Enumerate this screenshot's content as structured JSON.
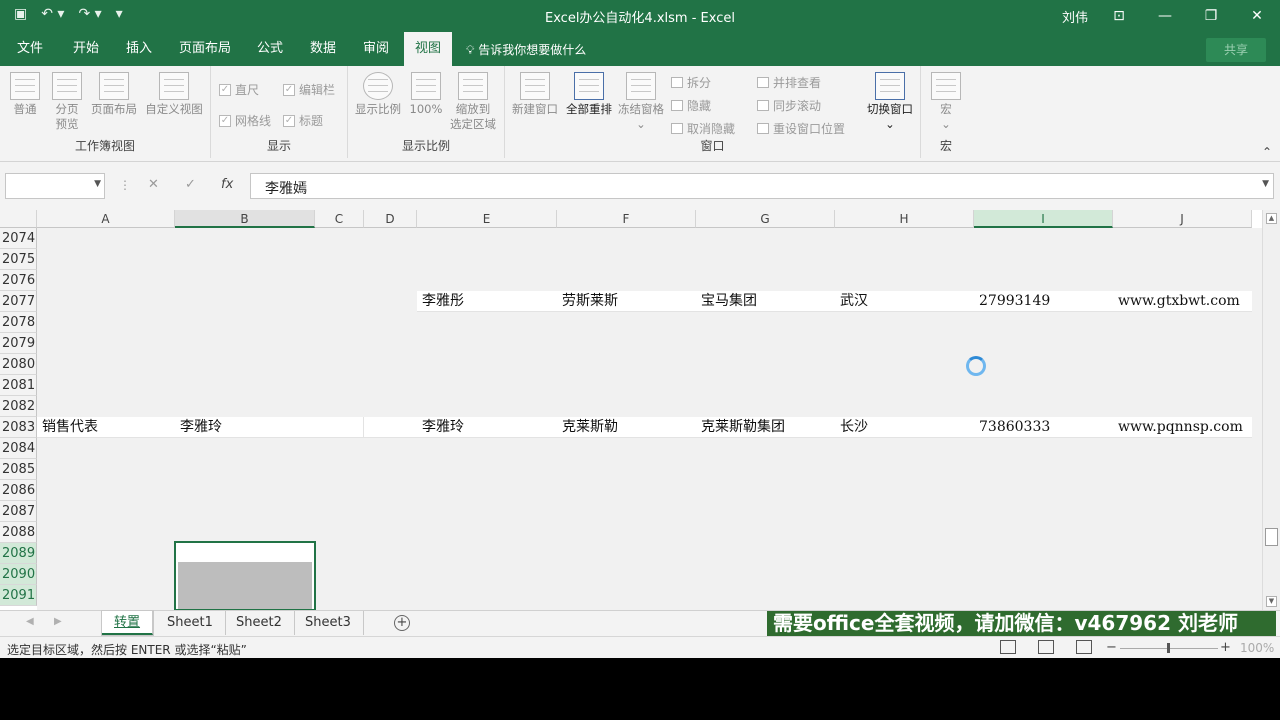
{
  "titlebar": {
    "title": "Excel办公自动化4.xlsm - Excel",
    "user": "刘伟",
    "qat": [
      "save-icon",
      "undo-icon",
      "redo-icon",
      "customize-icon"
    ],
    "buttons": [
      "ribbon-display-options",
      "minimize",
      "restore",
      "close"
    ]
  },
  "ribbon_tabs": [
    "文件",
    "开始",
    "插入",
    "页面布局",
    "公式",
    "数据",
    "审阅",
    "视图"
  ],
  "active_tab": "视图",
  "tell_me": "告诉我你想要做什么",
  "share_label": "共享",
  "ribbon": {
    "workbook_views": {
      "label": "工作簿视图",
      "buttons": [
        "普通",
        "分页\n预览",
        "页面布局",
        "自定义视图"
      ]
    },
    "show": {
      "label": "显示",
      "checks": [
        "直尺",
        "编辑栏",
        "网格线",
        "标题"
      ]
    },
    "zoom": {
      "label": "显示比例",
      "buttons": [
        "显示比例",
        "100%",
        "缩放到\n选定区域"
      ]
    },
    "window": {
      "label": "窗口",
      "buttons": [
        "新建窗口",
        "全部重排",
        "冻结窗格"
      ],
      "small": [
        "拆分",
        "隐藏",
        "取消隐藏",
        "并排查看",
        "同步滚动",
        "重设窗口位置"
      ],
      "switch": "切换窗口"
    },
    "macros": {
      "label": "宏",
      "button": "宏"
    }
  },
  "formula_bar": {
    "name_box": "",
    "formula": "李雅嫣"
  },
  "columns": [
    "A",
    "B",
    "C",
    "D",
    "E",
    "F",
    "G",
    "H",
    "I",
    "J"
  ],
  "rows": [
    "2074",
    "2075",
    "2076",
    "2077",
    "2078",
    "2079",
    "2080",
    "2081",
    "2082",
    "2083",
    "2084",
    "2085",
    "2086",
    "2087",
    "2088",
    "2089",
    "2090",
    "2091"
  ],
  "cells": {
    "r2077": {
      "E": "李雅彤",
      "F": "劳斯莱斯",
      "G": "宝马集团",
      "H": "武汉",
      "I": "27993149",
      "J": "www.gtxbwt.com"
    },
    "r2083": {
      "A": "销售代表",
      "B": "李雅玲",
      "E": "李雅玲",
      "F": "克莱斯勒",
      "G": "克莱斯勒集团",
      "H": "长沙",
      "I": "73860333",
      "J": "www.pqnnsp.com"
    }
  },
  "sheets": [
    "转置",
    "Sheet1",
    "Sheet2",
    "Sheet3"
  ],
  "active_sheet": "转置",
  "promo": "需要office全套视频，请加微信：v467962 刘老师",
  "status": {
    "message": "选定目标区域，然后按 ENTER 或选择“粘贴”",
    "zoom": "100%"
  },
  "colors": {
    "brand": "#217346",
    "promo_bg": "#2f6b2f"
  }
}
